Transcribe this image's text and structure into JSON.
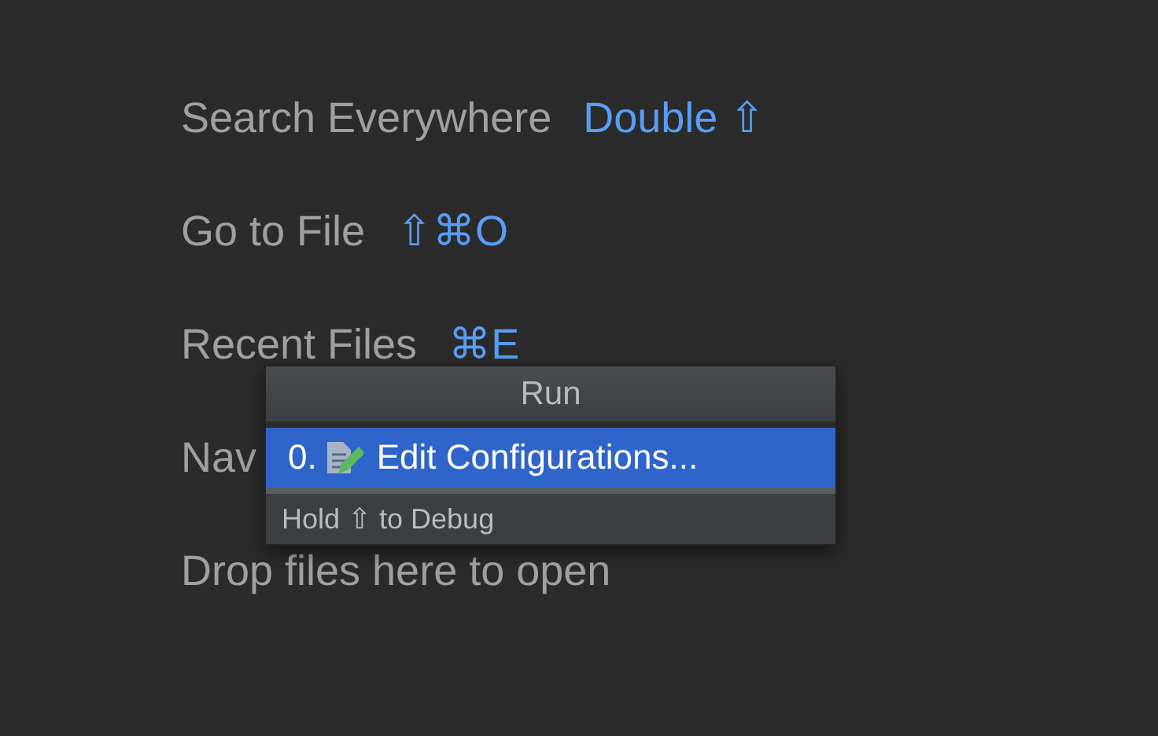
{
  "hints": [
    {
      "label": "Search Everywhere",
      "shortcut": "Double ⇧"
    },
    {
      "label": "Go to File",
      "shortcut": "⇧⌘O"
    },
    {
      "label": "Recent Files",
      "shortcut": "⌘E"
    },
    {
      "label": "Nav"
    },
    {
      "label": "Drop files here to open"
    }
  ],
  "popup": {
    "title": "Run",
    "items": [
      {
        "number": "0.",
        "label": "Edit Configurations...",
        "selected": true
      }
    ],
    "footer": "Hold ⇧ to Debug"
  }
}
